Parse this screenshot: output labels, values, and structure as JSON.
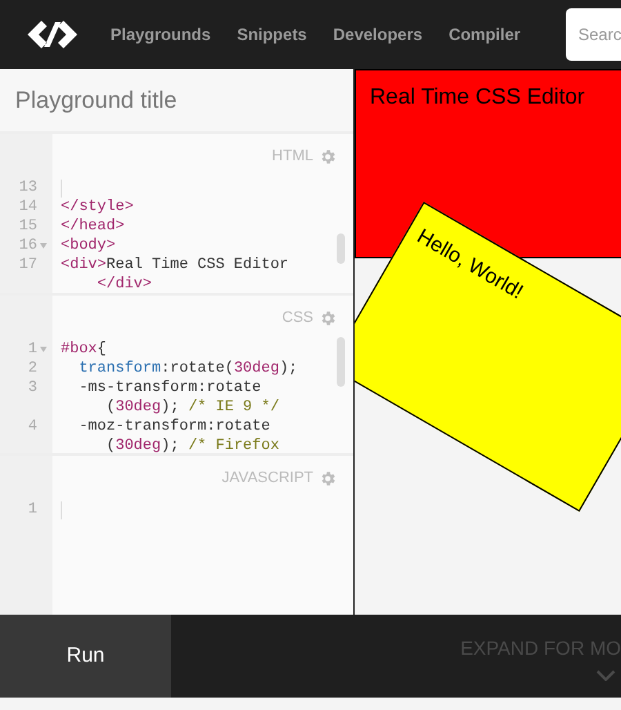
{
  "nav": {
    "links": [
      {
        "label": "Playgrounds"
      },
      {
        "label": "Snippets"
      },
      {
        "label": "Developers"
      },
      {
        "label": "Compiler"
      }
    ],
    "search": {
      "placeholder": "Searc"
    }
  },
  "title": {
    "placeholder": "Playground title"
  },
  "editors": [
    {
      "label": "HTML",
      "lines": [
        {
          "number": "13",
          "fold": false,
          "rows": [
            []
          ]
        },
        {
          "number": "14",
          "fold": false,
          "rows": [
            [
              {
                "kind": "tag",
                "text": "</style>"
              }
            ]
          ]
        },
        {
          "number": "15",
          "fold": false,
          "rows": [
            [
              {
                "kind": "tag",
                "text": "</head>"
              }
            ]
          ]
        },
        {
          "number": "16",
          "fold": true,
          "rows": [
            [
              {
                "kind": "tag",
                "text": "<body>"
              }
            ]
          ]
        },
        {
          "number": "17",
          "fold": false,
          "rows": [
            [
              {
                "kind": "tag",
                "text": "<div>"
              },
              {
                "kind": "text",
                "text": "Real Time CSS Editor"
              }
            ],
            [
              {
                "kind": "tag",
                "text": "    </div>"
              }
            ]
          ]
        }
      ]
    },
    {
      "label": "CSS",
      "lines": [
        {
          "number": "1",
          "fold": true,
          "rows": [
            [
              {
                "kind": "tag",
                "text": "#box"
              },
              {
                "kind": "text",
                "text": "{"
              }
            ]
          ]
        },
        {
          "number": "2",
          "fold": false,
          "rows": [
            [
              {
                "kind": "property",
                "text": "  transform"
              },
              {
                "kind": "text",
                "text": ":rotate("
              },
              {
                "kind": "number",
                "text": "30deg"
              },
              {
                "kind": "text",
                "text": ");"
              }
            ]
          ]
        },
        {
          "number": "3",
          "fold": false,
          "rows": [
            [
              {
                "kind": "text",
                "text": "  -ms-transform:rotate"
              }
            ],
            [
              {
                "kind": "text",
                "text": "     ("
              },
              {
                "kind": "number",
                "text": "30deg"
              },
              {
                "kind": "text",
                "text": "); "
              },
              {
                "kind": "comment",
                "text": "/* IE 9 */"
              }
            ]
          ]
        },
        {
          "number": "4",
          "fold": false,
          "rows": [
            [
              {
                "kind": "text",
                "text": "  -moz-transform:rotate"
              }
            ],
            [
              {
                "kind": "text",
                "text": "     ("
              },
              {
                "kind": "number",
                "text": "30deg"
              },
              {
                "kind": "text",
                "text": "); "
              },
              {
                "kind": "comment",
                "text": "/* Firefox"
              }
            ]
          ]
        }
      ]
    },
    {
      "label": "JAVASCRIPT",
      "lines": [
        {
          "number": "1",
          "fold": false,
          "rows": [
            []
          ]
        }
      ]
    }
  ],
  "preview": {
    "heading": "Real Time CSS Editor",
    "box_text": "Hello, World!"
  },
  "footer": {
    "run": "Run",
    "expand": "EXPAND FOR MO"
  }
}
